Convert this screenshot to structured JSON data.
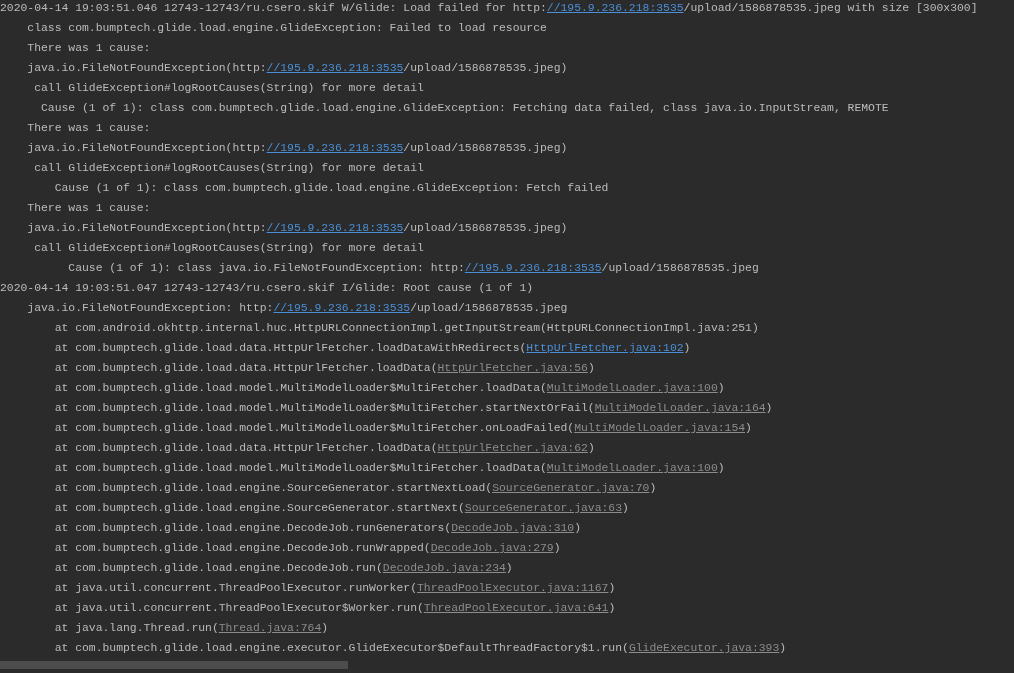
{
  "log_lines": [
    {
      "segments": [
        {
          "kind": "text",
          "text": "2020-04-14 19:03:51.046 12743-12743/ru.csero.skif W/Glide: Load failed for http:"
        },
        {
          "kind": "link",
          "text": "//195.9.236.218:3535"
        },
        {
          "kind": "text",
          "text": "/upload/1586878535.jpeg with size [300x300]"
        }
      ]
    },
    {
      "segments": [
        {
          "kind": "text",
          "text": "    class com.bumptech.glide.load.engine.GlideException: Failed to load resource"
        }
      ]
    },
    {
      "segments": [
        {
          "kind": "text",
          "text": "    There was 1 cause:"
        }
      ]
    },
    {
      "segments": [
        {
          "kind": "text",
          "text": "    java.io.FileNotFoundException(http:"
        },
        {
          "kind": "link",
          "text": "//195.9.236.218:3535"
        },
        {
          "kind": "text",
          "text": "/upload/1586878535.jpeg)"
        }
      ]
    },
    {
      "segments": [
        {
          "kind": "text",
          "text": "     call GlideException#logRootCauses(String) for more detail"
        }
      ]
    },
    {
      "segments": [
        {
          "kind": "text",
          "text": "      Cause (1 of 1): class com.bumptech.glide.load.engine.GlideException: Fetching data failed, class java.io.InputStream, REMOTE"
        }
      ]
    },
    {
      "segments": [
        {
          "kind": "text",
          "text": "    There was 1 cause:"
        }
      ]
    },
    {
      "segments": [
        {
          "kind": "text",
          "text": "    java.io.FileNotFoundException(http:"
        },
        {
          "kind": "link",
          "text": "//195.9.236.218:3535"
        },
        {
          "kind": "text",
          "text": "/upload/1586878535.jpeg)"
        }
      ]
    },
    {
      "segments": [
        {
          "kind": "text",
          "text": "     call GlideException#logRootCauses(String) for more detail"
        }
      ]
    },
    {
      "segments": [
        {
          "kind": "text",
          "text": "        Cause (1 of 1): class com.bumptech.glide.load.engine.GlideException: Fetch failed"
        }
      ]
    },
    {
      "segments": [
        {
          "kind": "text",
          "text": "    There was 1 cause:"
        }
      ]
    },
    {
      "segments": [
        {
          "kind": "text",
          "text": "    java.io.FileNotFoundException(http:"
        },
        {
          "kind": "link",
          "text": "//195.9.236.218:3535"
        },
        {
          "kind": "text",
          "text": "/upload/1586878535.jpeg)"
        }
      ]
    },
    {
      "segments": [
        {
          "kind": "text",
          "text": "     call GlideException#logRootCauses(String) for more detail"
        }
      ]
    },
    {
      "segments": [
        {
          "kind": "text",
          "text": "          Cause (1 of 1): class java.io.FileNotFoundException: http:"
        },
        {
          "kind": "link",
          "text": "//195.9.236.218:3535"
        },
        {
          "kind": "text",
          "text": "/upload/1586878535.jpeg"
        }
      ]
    },
    {
      "segments": [
        {
          "kind": "text",
          "text": "2020-04-14 19:03:51.047 12743-12743/ru.csero.skif I/Glide: Root cause (1 of 1)"
        }
      ]
    },
    {
      "segments": [
        {
          "kind": "text",
          "text": "    java.io.FileNotFoundException: http:"
        },
        {
          "kind": "link",
          "text": "//195.9.236.218:3535"
        },
        {
          "kind": "text",
          "text": "/upload/1586878535.jpeg"
        }
      ]
    },
    {
      "segments": [
        {
          "kind": "text",
          "text": "        at com.android.okhttp.internal.huc.HttpURLConnectionImpl.getInputStream(HttpURLConnectionImpl.java:251)"
        }
      ]
    },
    {
      "segments": [
        {
          "kind": "text",
          "text": "        at com.bumptech.glide.load.data.HttpUrlFetcher.loadDataWithRedirects("
        },
        {
          "kind": "link",
          "text": "HttpUrlFetcher.java:102"
        },
        {
          "kind": "text",
          "text": ")"
        }
      ]
    },
    {
      "segments": [
        {
          "kind": "text",
          "text": "        at com.bumptech.glide.load.data.HttpUrlFetcher.loadData("
        },
        {
          "kind": "file-link",
          "text": "HttpUrlFetcher.java:56"
        },
        {
          "kind": "text",
          "text": ")"
        }
      ]
    },
    {
      "segments": [
        {
          "kind": "text",
          "text": "        at com.bumptech.glide.load.model.MultiModelLoader$MultiFetcher.loadData("
        },
        {
          "kind": "file-link",
          "text": "MultiModelLoader.java:100"
        },
        {
          "kind": "text",
          "text": ")"
        }
      ]
    },
    {
      "segments": [
        {
          "kind": "text",
          "text": "        at com.bumptech.glide.load.model.MultiModelLoader$MultiFetcher.startNextOrFail("
        },
        {
          "kind": "file-link",
          "text": "MultiModelLoader.java:164"
        },
        {
          "kind": "text",
          "text": ")"
        }
      ]
    },
    {
      "segments": [
        {
          "kind": "text",
          "text": "        at com.bumptech.glide.load.model.MultiModelLoader$MultiFetcher.onLoadFailed("
        },
        {
          "kind": "file-link",
          "text": "MultiModelLoader.java:154"
        },
        {
          "kind": "text",
          "text": ")"
        }
      ]
    },
    {
      "segments": [
        {
          "kind": "text",
          "text": "        at com.bumptech.glide.load.data.HttpUrlFetcher.loadData("
        },
        {
          "kind": "file-link",
          "text": "HttpUrlFetcher.java:62"
        },
        {
          "kind": "text",
          "text": ")"
        }
      ]
    },
    {
      "segments": [
        {
          "kind": "text",
          "text": "        at com.bumptech.glide.load.model.MultiModelLoader$MultiFetcher.loadData("
        },
        {
          "kind": "file-link",
          "text": "MultiModelLoader.java:100"
        },
        {
          "kind": "text",
          "text": ")"
        }
      ]
    },
    {
      "segments": [
        {
          "kind": "text",
          "text": "        at com.bumptech.glide.load.engine.SourceGenerator.startNextLoad("
        },
        {
          "kind": "file-link",
          "text": "SourceGenerator.java:70"
        },
        {
          "kind": "text",
          "text": ")"
        }
      ]
    },
    {
      "segments": [
        {
          "kind": "text",
          "text": "        at com.bumptech.glide.load.engine.SourceGenerator.startNext("
        },
        {
          "kind": "file-link",
          "text": "SourceGenerator.java:63"
        },
        {
          "kind": "text",
          "text": ")"
        }
      ]
    },
    {
      "segments": [
        {
          "kind": "text",
          "text": "        at com.bumptech.glide.load.engine.DecodeJob.runGenerators("
        },
        {
          "kind": "file-link",
          "text": "DecodeJob.java:310"
        },
        {
          "kind": "text",
          "text": ")"
        }
      ]
    },
    {
      "segments": [
        {
          "kind": "text",
          "text": "        at com.bumptech.glide.load.engine.DecodeJob.runWrapped("
        },
        {
          "kind": "file-link",
          "text": "DecodeJob.java:279"
        },
        {
          "kind": "text",
          "text": ")"
        }
      ]
    },
    {
      "segments": [
        {
          "kind": "text",
          "text": "        at com.bumptech.glide.load.engine.DecodeJob.run("
        },
        {
          "kind": "file-link",
          "text": "DecodeJob.java:234"
        },
        {
          "kind": "text",
          "text": ")"
        }
      ]
    },
    {
      "segments": [
        {
          "kind": "text",
          "text": "        at java.util.concurrent.ThreadPoolExecutor.runWorker("
        },
        {
          "kind": "file-link",
          "text": "ThreadPoolExecutor.java:1167"
        },
        {
          "kind": "text",
          "text": ")"
        }
      ]
    },
    {
      "segments": [
        {
          "kind": "text",
          "text": "        at java.util.concurrent.ThreadPoolExecutor$Worker.run("
        },
        {
          "kind": "file-link",
          "text": "ThreadPoolExecutor.java:641"
        },
        {
          "kind": "text",
          "text": ")"
        }
      ]
    },
    {
      "segments": [
        {
          "kind": "text",
          "text": "        at java.lang.Thread.run("
        },
        {
          "kind": "file-link",
          "text": "Thread.java:764"
        },
        {
          "kind": "text",
          "text": ")"
        }
      ]
    },
    {
      "segments": [
        {
          "kind": "text",
          "text": "        at com.bumptech.glide.load.engine.executor.GlideExecutor$DefaultThreadFactory$1.run("
        },
        {
          "kind": "file-link",
          "text": "GlideExecutor.java:393"
        },
        {
          "kind": "text",
          "text": ")"
        }
      ]
    }
  ]
}
